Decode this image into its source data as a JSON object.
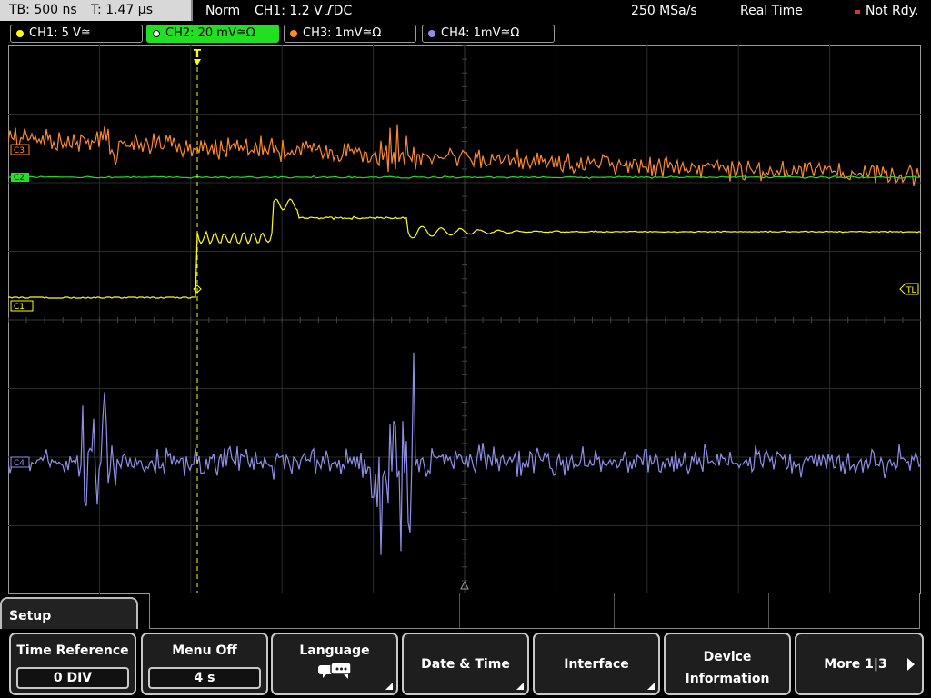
{
  "status_bar": {
    "timebase": "TB: 500 ns",
    "trigger_time": "T: 1.47 µs",
    "trigger_mode": "Norm",
    "trigger_source": "CH1: 1.2 V",
    "trigger_coupling": "DC",
    "sample_rate": "250 MSa/s",
    "acquisition_mode": "Real Time",
    "run_state": "Not Rdy."
  },
  "channels": [
    {
      "label": "CH1: 5 V≅",
      "color": "#ffff00",
      "active": false
    },
    {
      "label": "CH2: 20 mV≅Ω",
      "color": "#21e021",
      "active": true
    },
    {
      "label": "CH3: 1mV≅Ω",
      "color": "#ff8a2a",
      "active": false
    },
    {
      "label": "CH4: 1mV≅Ω",
      "color": "#8f8fe8",
      "active": false
    }
  ],
  "markers": {
    "ch1": "C1",
    "ch2": "C2",
    "ch3": "C3",
    "ch4": "C4",
    "trigger_level": "TL",
    "trigger_position": "T"
  },
  "chart_data": {
    "type": "line",
    "title": "",
    "xlabel": "",
    "ylabel": "",
    "grid": true,
    "divisions": {
      "horizontal": 10,
      "vertical": 8
    },
    "series": [
      {
        "name": "CH1",
        "color": "#ffff00"
      },
      {
        "name": "CH2",
        "color": "#21e021"
      },
      {
        "name": "CH3",
        "color": "#ff8a2a"
      },
      {
        "name": "CH4",
        "color": "#8f8fe8"
      }
    ]
  },
  "menu": {
    "title": "Setup",
    "softkeys": [
      {
        "label": "Time Reference",
        "value": "0 DIV"
      },
      {
        "label": "Menu Off",
        "value": "4 s"
      },
      {
        "label": "Language"
      },
      {
        "label": "Date & Time"
      },
      {
        "label": "Interface"
      },
      {
        "label_line1": "Device",
        "label_line2": "Information"
      },
      {
        "label": "More 1|3"
      }
    ]
  }
}
